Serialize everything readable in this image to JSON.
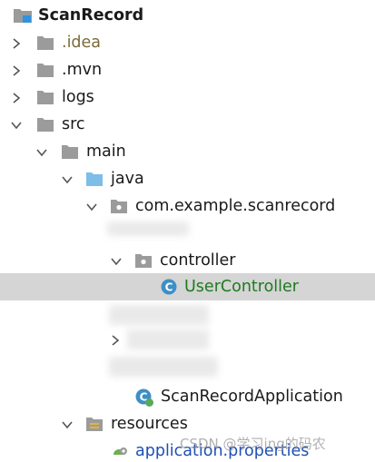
{
  "project": {
    "name": "ScanRecord"
  },
  "tree": {
    "idea": ".idea",
    "mvn": ".mvn",
    "logs": "logs",
    "src": "src",
    "main": "main",
    "java": "java",
    "package": "com.example.scanrecord",
    "controller": "controller",
    "user_controller": "UserController",
    "application_class": "ScanRecordApplication",
    "resources": "resources",
    "application_properties": "application.properties"
  },
  "watermark": "CSDN @学习ing的码农",
  "colors": {
    "selection_bg": "#d5d5d5",
    "folder_gray": "#9b9b9b",
    "folder_source_blue": "#7dbde8",
    "class_icon_blue": "#3d8fc6",
    "green_text": "#1f7a1f",
    "blue_text": "#1f4fb4"
  },
  "icons": {
    "collapsed": "chevron-right-icon",
    "expanded": "chevron-down-icon",
    "folder": "folder-icon",
    "source_folder": "source-folder-icon",
    "package": "package-icon",
    "class": "class-icon",
    "spring_boot_app": "spring-boot-app-icon",
    "resources_folder": "resources-folder-icon",
    "properties_file": "properties-file-icon"
  }
}
